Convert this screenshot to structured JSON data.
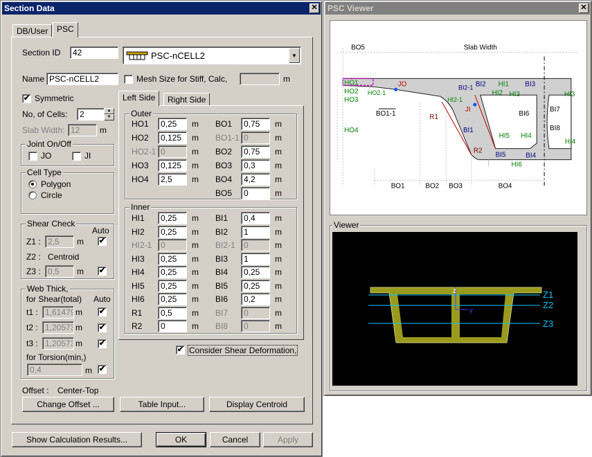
{
  "dialog": {
    "title": "Section Data",
    "tabs": [
      "DB/User",
      "PSC"
    ],
    "section_id_label": "Section ID",
    "section_id": "42",
    "section_type": "PSC-nCELL2",
    "name_label": "Name",
    "name": "PSC-nCELL2",
    "mesh_label": "Mesh Size for Stiff, Calc,",
    "mesh_unit": "m",
    "symmetric_label": "Symmetric",
    "symmetric_check": "✔",
    "cells_label": "No, of Cells:",
    "cells": "2",
    "slab_label": "Slab Width:",
    "slab_value": "12",
    "slab_unit": "m",
    "joint_title": "Joint On/Off",
    "jo_label": "JO",
    "ji_label": "JI",
    "celltype_title": "Cell Type",
    "polygon_label": "Polygon",
    "circle_label": "Circle",
    "shear_title": "Shear Check",
    "auto_label": "Auto",
    "z1_label": "Z1 :",
    "z1_value": "2,5",
    "z2_label": "Z2 :",
    "z2_value": "Centroid",
    "z3_label": "Z3 :",
    "z3_value": "0,5",
    "unit_m": "m",
    "check_mark": "✔",
    "web_title": "Web Thick,",
    "web_sub": "for Shear(total)",
    "t1_label": "t1 :",
    "t1_value": "1,61479",
    "t2_label": "t2 :",
    "t2_value": "1,20573",
    "t3_label": "t3 :",
    "t3_value": "1,20573",
    "torsion_label": "for Torsion(min,)",
    "torsion_value": "0,4",
    "offset_label": "Offset :",
    "offset_value": "Center-Top",
    "side_tabs": [
      "Left Side",
      "Right Side"
    ],
    "outer_title": "Outer",
    "inner_title": "Inner",
    "consider_label": "Consider Shear Deformation,",
    "btn_change_offset": "Change Offset ...",
    "btn_table_input": "Table Input...",
    "btn_display_centroid": "Display Centroid",
    "btn_show_calc": "Show Calculation Results...",
    "btn_ok": "OK",
    "btn_cancel": "Cancel",
    "btn_apply": "Apply"
  },
  "outer_left": [
    {
      "label": "HO1",
      "value": "0,25",
      "disabled": false
    },
    {
      "label": "HO2",
      "value": "0,125",
      "disabled": false
    },
    {
      "label": "HO2-1",
      "value": "0",
      "disabled": true
    },
    {
      "label": "HO3",
      "value": "0,125",
      "disabled": false
    },
    {
      "label": "HO4",
      "value": "2,5",
      "disabled": false
    }
  ],
  "outer_right": [
    {
      "label": "BO1",
      "value": "0,75",
      "disabled": false
    },
    {
      "label": "BO1-1",
      "value": "0",
      "disabled": true
    },
    {
      "label": "BO2",
      "value": "0,75",
      "disabled": false
    },
    {
      "label": "BO3",
      "value": "0,3",
      "disabled": false
    },
    {
      "label": "BO4",
      "value": "4,2",
      "disabled": false
    },
    {
      "label": "BO5",
      "value": "0",
      "disabled": false
    }
  ],
  "inner_left": [
    {
      "label": "HI1",
      "value": "0,25",
      "disabled": false
    },
    {
      "label": "HI2",
      "value": "0,25",
      "disabled": false
    },
    {
      "label": "HI2-1",
      "value": "0",
      "disabled": true
    },
    {
      "label": "HI3",
      "value": "0,25",
      "disabled": false
    },
    {
      "label": "HI4",
      "value": "0,25",
      "disabled": false
    },
    {
      "label": "HI5",
      "value": "0,25",
      "disabled": false
    },
    {
      "label": "HI6",
      "value": "0,25",
      "disabled": false
    },
    {
      "label": "R1",
      "value": "0,5",
      "disabled": false
    },
    {
      "label": "R2",
      "value": "0",
      "disabled": false
    }
  ],
  "inner_right": [
    {
      "label": "BI1",
      "value": "0,4",
      "disabled": false
    },
    {
      "label": "BI2",
      "value": "1",
      "disabled": false
    },
    {
      "label": "BI2-1",
      "value": "0",
      "disabled": true
    },
    {
      "label": "BI3",
      "value": "1",
      "disabled": false
    },
    {
      "label": "BI4",
      "value": "0,25",
      "disabled": false
    },
    {
      "label": "BI5",
      "value": "0,25",
      "disabled": false
    },
    {
      "label": "BI6",
      "value": "0,2",
      "disabled": false
    },
    {
      "label": "BI7",
      "value": "0",
      "disabled": true
    },
    {
      "label": "BI8",
      "value": "0",
      "disabled": true
    }
  ],
  "viewer": {
    "title": "PSC Viewer",
    "viewer_group": "Viewer",
    "diagram": {
      "bo5": "BO5",
      "slab_width": "Slab Width",
      "ho1": "HO1",
      "ho2": "HO2",
      "ho2_1": "HO2-1",
      "ho3": "HO3",
      "ho4": "HO4",
      "jo": "JO",
      "ji": "JI",
      "r1": "R1",
      "r2": "R2",
      "bo1_1": "BO1-1",
      "bo1": "BO1",
      "bo2": "BO2",
      "bo3": "BO3",
      "bo4": "BO4",
      "hi1": "HI1",
      "hi2": "HI2",
      "hi2_1": "HI2-1",
      "hi3": "HI3",
      "hi4": "HI4",
      "hi5": "HI5",
      "hi6": "HI6",
      "bi1": "BI1",
      "bi2": "BI2",
      "bi2_1": "BI2-1",
      "bi3": "BI3",
      "bi4": "BI4",
      "bi5": "BI5",
      "bi6": "BI6",
      "bi7": "BI7",
      "bi8": "BI8"
    },
    "z1": "Z1",
    "z2": "Z2",
    "z3": "Z3",
    "axis_z": "z",
    "axis_y": "y",
    "colors": {
      "section_fill": "#9a9a1e",
      "z_lines": "#00c8ff",
      "background": "#000000"
    }
  }
}
